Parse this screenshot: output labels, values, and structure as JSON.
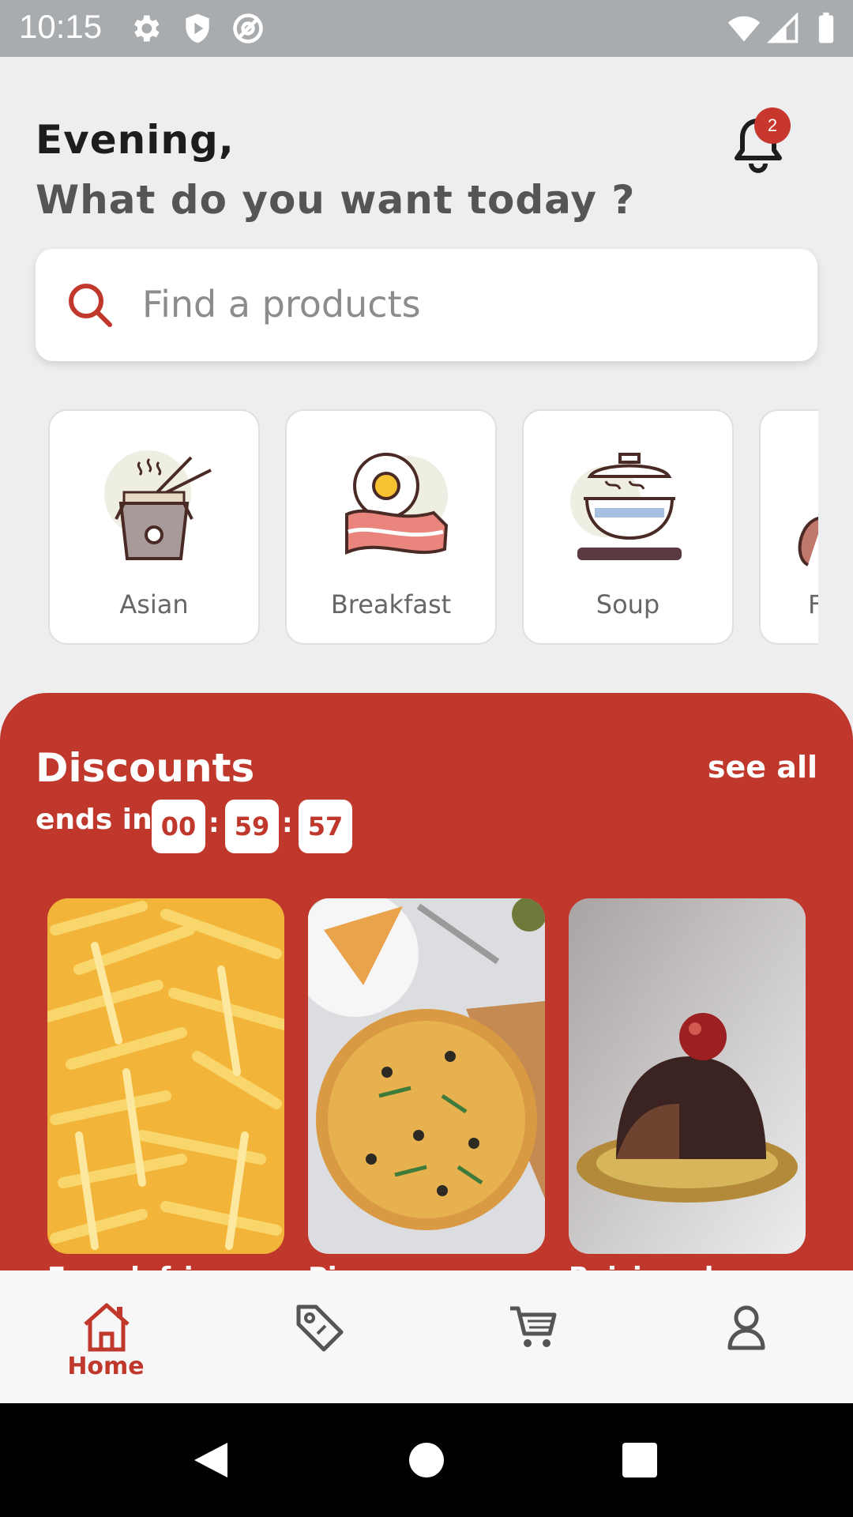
{
  "status_bar": {
    "time": "10:15"
  },
  "header": {
    "greeting": "Evening,",
    "question": "What do you want today ?",
    "notification_count": "2"
  },
  "search": {
    "placeholder": "Find a products"
  },
  "categories": [
    {
      "label": "Asian"
    },
    {
      "label": "Breakfast"
    },
    {
      "label": "Soup"
    },
    {
      "label": "F"
    }
  ],
  "discounts": {
    "title": "Discounts",
    "see_all": "see all",
    "ends_in": "ends in",
    "timer": {
      "hours": "00",
      "minutes": "59",
      "seconds": "57"
    },
    "products": [
      {
        "name": "French fries"
      },
      {
        "name": "Pizza"
      },
      {
        "name": "Raisin cake"
      }
    ]
  },
  "bottom_nav": {
    "home_label": "Home"
  },
  "colors": {
    "accent": "#c0372b",
    "background": "#eceef0"
  }
}
